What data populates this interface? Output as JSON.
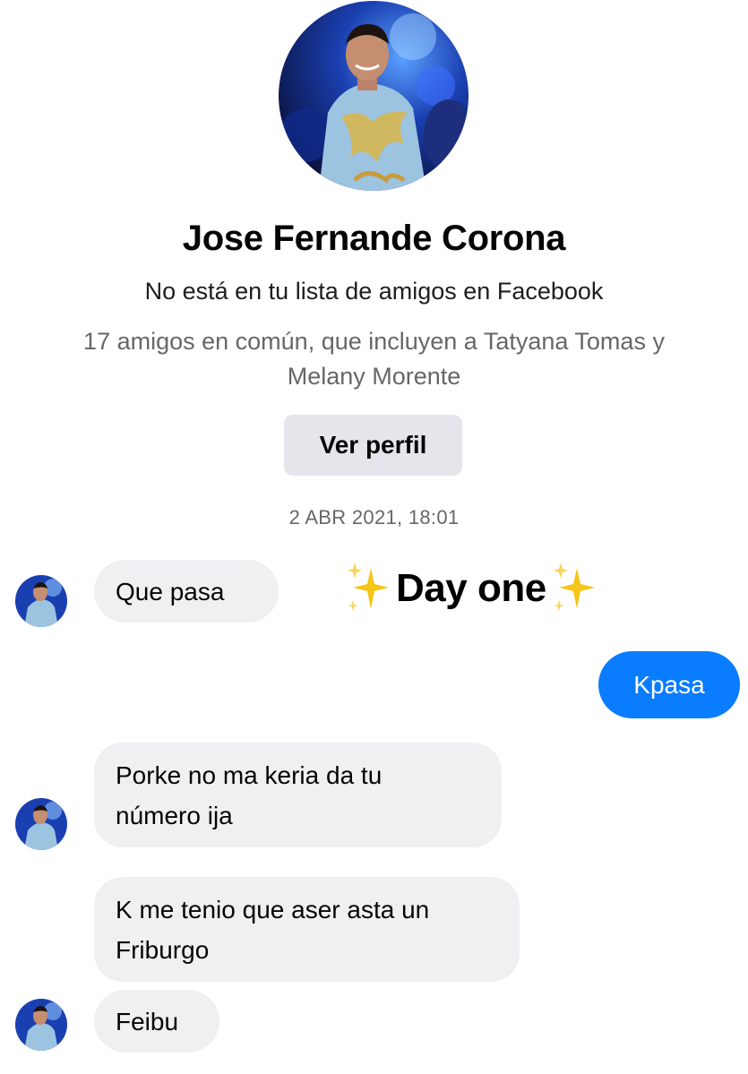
{
  "profile": {
    "name": "Jose Fernande Corona",
    "friend_status": "No está en tu lista de amigos en Facebook",
    "mutual_friends": "17 amigos en común, que incluyen a Tatyana Tomas y Melany Morente",
    "view_profile_label": "Ver perfil",
    "avatar_icon": "profile-photo"
  },
  "thread": {
    "timestamp": "2 ABR 2021, 18:01",
    "messages": [
      {
        "sender": "contact",
        "text": "Que pasa"
      },
      {
        "sender": "me",
        "text": "Kpasa"
      },
      {
        "sender": "contact",
        "text": "Porke no ma keria da tu número ija"
      },
      {
        "sender": "contact",
        "text": "K me tenio que aser asta un Friburgo"
      },
      {
        "sender": "contact",
        "text": "Feibu"
      }
    ]
  },
  "overlay": {
    "text": "Day one",
    "decoration_icon": "sparkles-emoji"
  },
  "colors": {
    "outgoing_bubble": "#0a7cff",
    "incoming_bubble": "#f0f0f3",
    "button_bg": "#e4e6eb",
    "secondary_text": "#65676b",
    "sparkle": "#f5c518"
  }
}
